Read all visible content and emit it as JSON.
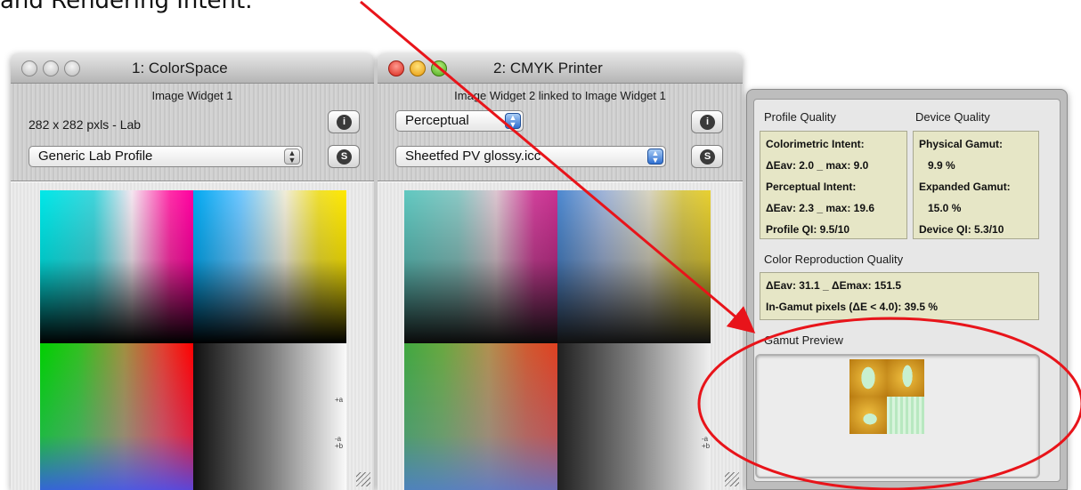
{
  "caption": "and Rendering Intent.",
  "win1": {
    "title": "1: ColorSpace",
    "subtitle": "Image Widget 1",
    "info": "282 x 282 pxls - Lab",
    "profile_popup": "Generic Lab Profile",
    "info_button": "i",
    "s_button": "S"
  },
  "win2": {
    "title": "2: CMYK Printer",
    "subtitle": "Image Widget 2 linked to Image Widget 1",
    "intent_popup": "Perceptual",
    "profile_popup": "Sheetfed PV glossy.icc",
    "info_button": "i",
    "s_button": "S"
  },
  "axis_ticks": {
    "plus_a": "+a",
    "minus_a_plus_b": "-a\n+b",
    "minus_a": "-a"
  },
  "quality": {
    "profile_quality_heading": "Profile Quality",
    "device_quality_heading": "Device Quality",
    "colorimetric_label": "Colorimetric Intent:",
    "colorimetric_values": "ΔEav: 2.0 _ max: 9.0",
    "perceptual_label": "Perceptual Intent:",
    "perceptual_values": "ΔEav: 2.3 _ max: 19.6",
    "profile_qi": "Profile QI: 9.5/10",
    "physical_gamut_label": "Physical Gamut:",
    "physical_gamut_value": "9.9 %",
    "expanded_gamut_label": "Expanded Gamut:",
    "expanded_gamut_value": "15.0 %",
    "device_qi": "Device QI: 5.3/10",
    "color_repro_heading": "Color Reproduction Quality",
    "repro_line1": "ΔEav: 31.1 _ ΔEmax: 151.5",
    "repro_line2": "In-Gamut pixels (ΔE < 4.0): 39.5 %",
    "gamut_preview_heading": "Gamut Preview"
  },
  "annotation_color": "#e8141a"
}
